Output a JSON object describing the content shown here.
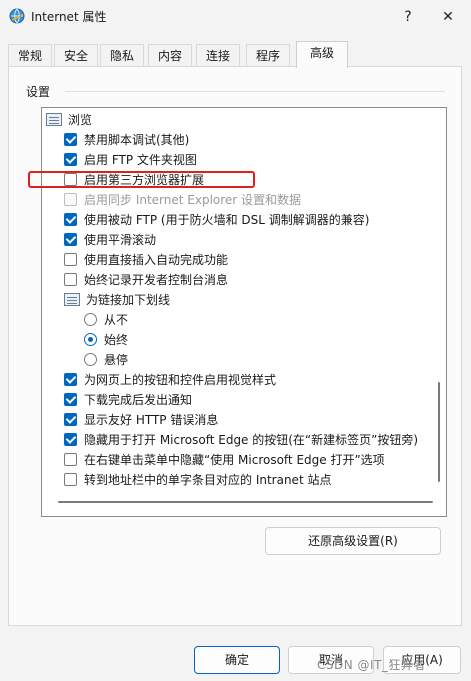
{
  "window": {
    "title": "Internet 属性",
    "help_label": "?",
    "close_label": "✕"
  },
  "tabs": [
    {
      "label": "常规",
      "active": false
    },
    {
      "label": "安全",
      "active": false
    },
    {
      "label": "隐私",
      "active": false
    },
    {
      "label": "内容",
      "active": false
    },
    {
      "label": "连接",
      "active": false
    },
    {
      "label": "程序",
      "active": false
    },
    {
      "label": "高级",
      "active": true
    }
  ],
  "settings": {
    "group_label": "设置",
    "items": [
      {
        "kind": "folder",
        "label": "浏览"
      },
      {
        "kind": "checkbox",
        "label": "禁用脚本调试(其他)",
        "checked": true,
        "disabled": false
      },
      {
        "kind": "checkbox",
        "label": "启用 FTP 文件夹视图",
        "checked": true,
        "disabled": false
      },
      {
        "kind": "checkbox",
        "label": "启用第三方浏览器扩展",
        "checked": false,
        "disabled": false,
        "highlighted": true
      },
      {
        "kind": "checkbox",
        "label": "启用同步 Internet Explorer 设置和数据",
        "checked": false,
        "disabled": true
      },
      {
        "kind": "checkbox",
        "label": "使用被动 FTP (用于防火墙和 DSL 调制解调器的兼容)",
        "checked": true,
        "disabled": false
      },
      {
        "kind": "checkbox",
        "label": "使用平滑滚动",
        "checked": true,
        "disabled": false
      },
      {
        "kind": "checkbox",
        "label": "使用直接插入自动完成功能",
        "checked": false,
        "disabled": false
      },
      {
        "kind": "checkbox",
        "label": "始终记录开发者控制台消息",
        "checked": false,
        "disabled": false
      },
      {
        "kind": "folder",
        "label": "为链接加下划线"
      },
      {
        "kind": "radio",
        "label": "从不",
        "checked": false
      },
      {
        "kind": "radio",
        "label": "始终",
        "checked": true
      },
      {
        "kind": "radio",
        "label": "悬停",
        "checked": false
      },
      {
        "kind": "checkbox",
        "label": "为网页上的按钮和控件启用视觉样式",
        "checked": true,
        "disabled": false
      },
      {
        "kind": "checkbox",
        "label": "下载完成后发出通知",
        "checked": true,
        "disabled": false
      },
      {
        "kind": "checkbox",
        "label": "显示友好 HTTP 错误消息",
        "checked": true,
        "disabled": false
      },
      {
        "kind": "checkbox",
        "label": "隐藏用于打开 Microsoft Edge 的按钮(在“新建标签页”按钮旁)",
        "checked": true,
        "disabled": false
      },
      {
        "kind": "checkbox",
        "label": "在右键单击菜单中隐藏“使用 Microsoft Edge 打开”选项",
        "checked": false,
        "disabled": false
      },
      {
        "kind": "checkbox",
        "label": "转到地址栏中的单字条目对应的 Intranet 站点",
        "checked": false,
        "disabled": false
      }
    ]
  },
  "buttons": {
    "restore": "还原高级设置(R)",
    "ok": "确定",
    "cancel": "取消",
    "apply": "应用(A)"
  },
  "watermark": "CSDN @IT_狂奔者",
  "colors": {
    "accent": "#0067c0",
    "highlight_box": "#e02020"
  }
}
